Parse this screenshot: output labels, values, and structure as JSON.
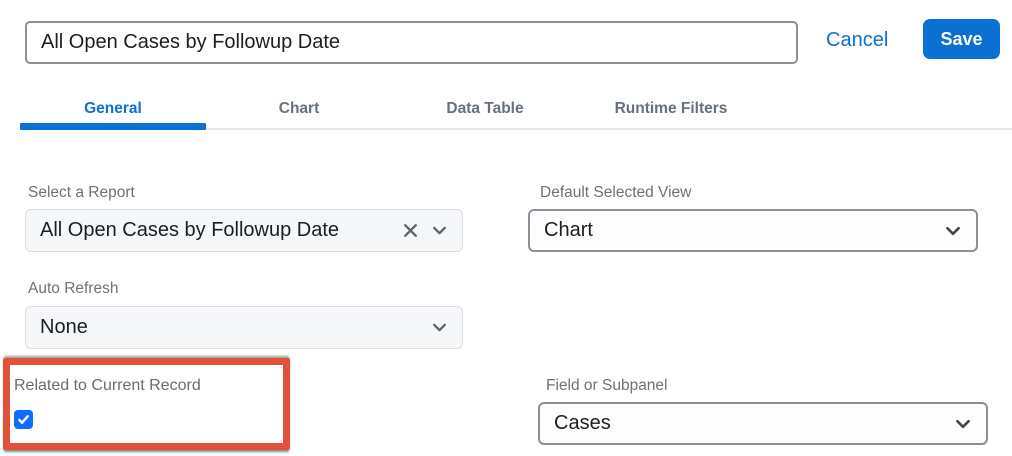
{
  "header": {
    "title_value": "All Open Cases by Followup Date",
    "cancel_label": "Cancel",
    "save_label": "Save"
  },
  "tabs": [
    {
      "label": "General",
      "active": true
    },
    {
      "label": "Chart",
      "active": false
    },
    {
      "label": "Data Table",
      "active": false
    },
    {
      "label": "Runtime Filters",
      "active": false
    }
  ],
  "fields": {
    "select_report": {
      "label": "Select a Report",
      "value": "All Open Cases by Followup Date"
    },
    "default_selected_view": {
      "label": "Default Selected View",
      "value": "Chart"
    },
    "auto_refresh": {
      "label": "Auto Refresh",
      "value": "None"
    },
    "related_to_current_record": {
      "label": "Related to Current Record",
      "checked": true
    },
    "field_or_subpanel": {
      "label": "Field or Subpanel",
      "value": "Cases"
    }
  },
  "icons": {
    "clear": "x-cross",
    "chevron": "chevron-down",
    "checkbox_check": "checkmark"
  },
  "colors": {
    "accent_blue": "#0c70d2",
    "checkbox_blue": "#0d6efd",
    "annotation_red": "#e0523a",
    "label_gray": "#6a737b"
  },
  "annotation": {
    "type": "highlight-rectangle",
    "highlights": "related_to_current_record"
  }
}
